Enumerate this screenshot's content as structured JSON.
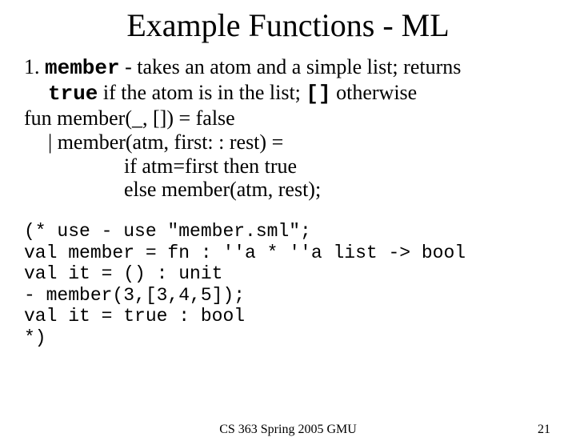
{
  "title": "Example Functions - ML",
  "item_number": "1.",
  "func_name": "member",
  "desc_part1": " - takes an atom and a simple list; returns ",
  "kw_true": "true",
  "desc_part2": " if the atom is in the list; ",
  "kw_empty": "[]",
  "desc_part3": " otherwise",
  "code_line1": "fun member(_, []) = false",
  "code_line2": "|   member(atm, first: : rest) =",
  "code_line3": "if atm=first then true",
  "code_line4": "else member(atm, rest);",
  "repl": {
    "l1": "(* use - use \"member.sml\";",
    "l2": "val member = fn : ''a * ''a list -> bool",
    "l3": "val it = () : unit",
    "l4": "- member(3,[3,4,5]);",
    "l5": "val it = true : bool",
    "l6": "*)"
  },
  "footer_center": "CS 363 Spring 2005 GMU",
  "footer_right": "21"
}
